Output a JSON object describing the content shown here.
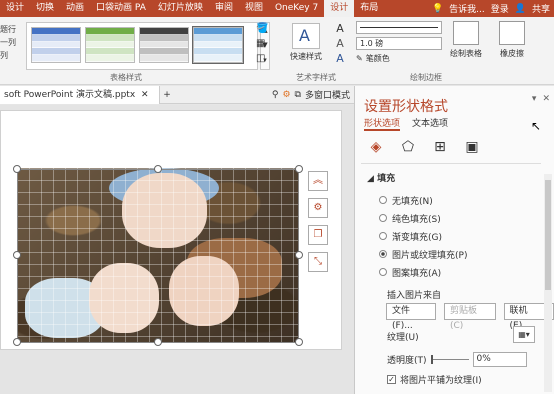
{
  "ribbon_tabs": {
    "items": [
      "设计",
      "切换",
      "动画",
      "口袋动画 PA",
      "幻灯片放映",
      "审阅",
      "视图",
      "OneKey 7",
      "设计",
      "布局"
    ],
    "active_index": 8,
    "tell_me": "告诉我...",
    "login": "登录",
    "share": "共享"
  },
  "ribbon": {
    "left_col": [
      "题行",
      "一列",
      "列"
    ],
    "table_styles_label": "表格样式",
    "quick_style_label": "快速样式",
    "art_text_label": "艺术字样式",
    "line_weight": "1.0 磅",
    "pen_color": "笔颜色",
    "draw_table": "绘制表格",
    "eraser": "橡皮擦",
    "draw_border_label": "绘制边框",
    "gallery_colors": [
      "#4472c4",
      "#70ad47",
      "#404040",
      "#5b9bd5"
    ]
  },
  "doc_tabs": {
    "active_tab": "soft PowerPoint 演示文稿.pptx",
    "multi_window": "多窗口模式"
  },
  "format_pane": {
    "title": "设置形状格式",
    "tab_shape": "形状选项",
    "tab_text": "文本选项",
    "fill_header": "填充",
    "fill_options": [
      "无填充(N)",
      "纯色填充(S)",
      "渐变填充(G)",
      "图片或纹理填充(P)",
      "图案填充(A)"
    ],
    "selected_fill_index": 3,
    "insert_from": "插入图片来自",
    "btn_file": "文件(F)...",
    "btn_clipboard": "剪贴板(C)",
    "btn_online": "联机(E)...",
    "texture_label": "纹理(U)",
    "transparency_label": "透明度(T)",
    "transparency_value": "0%",
    "tile_label": "将图片平铺为纹理(I)",
    "tile_checked": true
  }
}
